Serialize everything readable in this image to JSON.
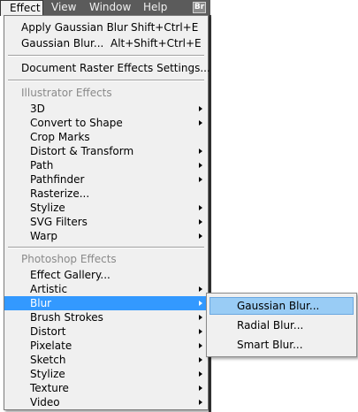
{
  "menubar": {
    "items": [
      "Effect",
      "View",
      "Window",
      "Help"
    ],
    "badge": "Br"
  },
  "menu": {
    "top_items": [
      {
        "label": "Apply Gaussian Blur",
        "shortcut": "Shift+Ctrl+E"
      },
      {
        "label": "Gaussian Blur...",
        "shortcut": "Alt+Shift+Ctrl+E"
      }
    ],
    "doc_settings": "Document Raster Effects Settings...",
    "illustrator_header": "Illustrator Effects",
    "illustrator_items": [
      {
        "label": "3D",
        "submenu": true
      },
      {
        "label": "Convert to Shape",
        "submenu": true
      },
      {
        "label": "Crop Marks",
        "submenu": false
      },
      {
        "label": "Distort & Transform",
        "submenu": true
      },
      {
        "label": "Path",
        "submenu": true
      },
      {
        "label": "Pathfinder",
        "submenu": true
      },
      {
        "label": "Rasterize...",
        "submenu": false
      },
      {
        "label": "Stylize",
        "submenu": true
      },
      {
        "label": "SVG Filters",
        "submenu": true
      },
      {
        "label": "Warp",
        "submenu": true
      }
    ],
    "photoshop_header": "Photoshop Effects",
    "photoshop_items": [
      {
        "label": "Effect Gallery...",
        "submenu": false
      },
      {
        "label": "Artistic",
        "submenu": true
      },
      {
        "label": "Blur",
        "submenu": true,
        "highlighted": true
      },
      {
        "label": "Brush Strokes",
        "submenu": true
      },
      {
        "label": "Distort",
        "submenu": true
      },
      {
        "label": "Pixelate",
        "submenu": true
      },
      {
        "label": "Sketch",
        "submenu": true
      },
      {
        "label": "Stylize",
        "submenu": true
      },
      {
        "label": "Texture",
        "submenu": true
      },
      {
        "label": "Video",
        "submenu": true
      }
    ]
  },
  "submenu": {
    "items": [
      {
        "label": "Gaussian Blur...",
        "highlighted": true
      },
      {
        "label": "Radial Blur..."
      },
      {
        "label": "Smart Blur..."
      }
    ]
  },
  "colors": {
    "highlight": "#3399ff",
    "submenu_highlight": "#99ccf5",
    "menubar_bg": "#5b5b5b"
  }
}
